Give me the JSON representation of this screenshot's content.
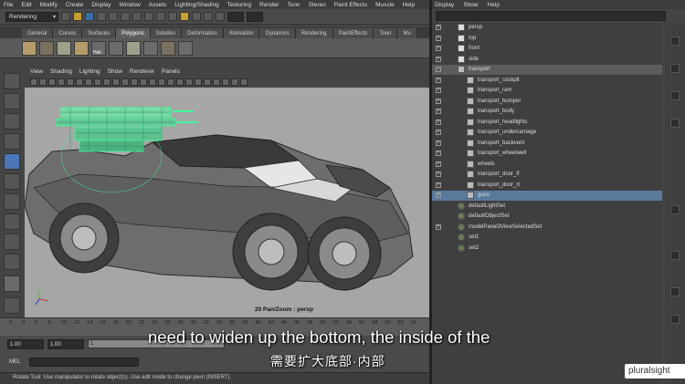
{
  "main_menu": [
    "File",
    "Edit",
    "Modify",
    "Create",
    "Display",
    "Window",
    "Assets",
    "Lighting/Shading",
    "Texturing",
    "Render",
    "Toon",
    "Stereo",
    "Paint Effects",
    "Muscle",
    "Help"
  ],
  "statusline": {
    "menu_set": "Rendering"
  },
  "shelf_tabs": [
    "General",
    "Curves",
    "Surfaces",
    "Polygons",
    "Subdivs",
    "Deformation",
    "Animation",
    "Dynamics",
    "Rendering",
    "PaintEffects",
    "Toon",
    "Mu"
  ],
  "shelf": {
    "hist_label": "Hist"
  },
  "panel_menu": [
    "View",
    "Shading",
    "Lighting",
    "Show",
    "Renderer",
    "Panels"
  ],
  "viewport": {
    "camera_label": "20 Pan/Zoom : persp"
  },
  "time_slider": {
    "ticks": [
      "2",
      "4",
      "6",
      "8",
      "10",
      "12",
      "14",
      "16",
      "18",
      "20",
      "22",
      "24",
      "26",
      "28",
      "30",
      "32",
      "34",
      "36",
      "38",
      "40",
      "42",
      "44",
      "46",
      "48",
      "50",
      "52",
      "54",
      "56",
      "58",
      "60",
      "62",
      "64"
    ]
  },
  "range_slider": {
    "start": "1.00",
    "playback_start": "1.00",
    "current": "1"
  },
  "command_line": {
    "label": "MEL"
  },
  "help_line": "Rotate Tool: Use manipulator to rotate object(s). Use edit mode to change pivot (INSERT).",
  "outliner": {
    "menu": [
      "Display",
      "Show",
      "Help"
    ],
    "items": [
      {
        "label": "persp",
        "icon": "camera-icon",
        "indent": 0,
        "expander": "+",
        "state": ""
      },
      {
        "label": "top",
        "icon": "camera-icon",
        "indent": 0,
        "expander": "+",
        "state": ""
      },
      {
        "label": "front",
        "icon": "camera-icon",
        "indent": 0,
        "expander": "+",
        "state": ""
      },
      {
        "label": "side",
        "icon": "camera-icon",
        "indent": 0,
        "expander": "+",
        "state": ""
      },
      {
        "label": "transport",
        "icon": "mesh-icon",
        "indent": 0,
        "expander": "−",
        "state": "sel2"
      },
      {
        "label": "transport_cockpit",
        "icon": "mesh-icon",
        "indent": 1,
        "expander": "+",
        "state": ""
      },
      {
        "label": "transport_ram",
        "icon": "mesh-icon",
        "indent": 1,
        "expander": "+",
        "state": ""
      },
      {
        "label": "transport_bumper",
        "icon": "joint-icon",
        "indent": 1,
        "expander": "+",
        "state": ""
      },
      {
        "label": "transport_body",
        "icon": "mesh-icon",
        "indent": 1,
        "expander": "+",
        "state": ""
      },
      {
        "label": "transport_headlights",
        "icon": "mesh-icon",
        "indent": 1,
        "expander": "+",
        "state": ""
      },
      {
        "label": "transport_undercarriage",
        "icon": "mesh-icon",
        "indent": 1,
        "expander": "+",
        "state": ""
      },
      {
        "label": "transport_backvent",
        "icon": "mesh-icon",
        "indent": 1,
        "expander": "+",
        "state": ""
      },
      {
        "label": "transport_wheelwell",
        "icon": "mesh-icon",
        "indent": 1,
        "expander": "+",
        "state": ""
      },
      {
        "label": "wheels",
        "icon": "mesh-icon",
        "indent": 1,
        "expander": "+",
        "state": ""
      },
      {
        "label": "transport_door_lf",
        "icon": "mesh-icon",
        "indent": 1,
        "expander": "+",
        "state": ""
      },
      {
        "label": "transport_door_rt",
        "icon": "mesh-icon",
        "indent": 1,
        "expander": "+",
        "state": ""
      },
      {
        "label": "guns",
        "icon": "mesh-icon",
        "indent": 1,
        "expander": "+",
        "state": "sel"
      },
      {
        "label": "defaultLightSet",
        "icon": "set-icon",
        "indent": 0,
        "expander": "",
        "state": ""
      },
      {
        "label": "defaultObjectSet",
        "icon": "set-icon",
        "indent": 0,
        "expander": "",
        "state": ""
      },
      {
        "label": "modelPanel3ViewSelectedSet",
        "icon": "set-icon",
        "indent": 0,
        "expander": "+",
        "state": ""
      },
      {
        "label": "set1",
        "icon": "set-icon",
        "indent": 0,
        "expander": "",
        "state": ""
      },
      {
        "label": "set2",
        "icon": "set-icon",
        "indent": 0,
        "expander": "",
        "state": ""
      }
    ]
  },
  "subtitles": {
    "english": "need to widen up the bottom, the inside of the",
    "chinese": "需要扩大底部·内部"
  },
  "watermark": "pluralsight",
  "colors": {
    "selection": "#5a7a9c",
    "wireframe_highlight": "#3dff9a",
    "viewport_bg": "#a6a6a6"
  }
}
